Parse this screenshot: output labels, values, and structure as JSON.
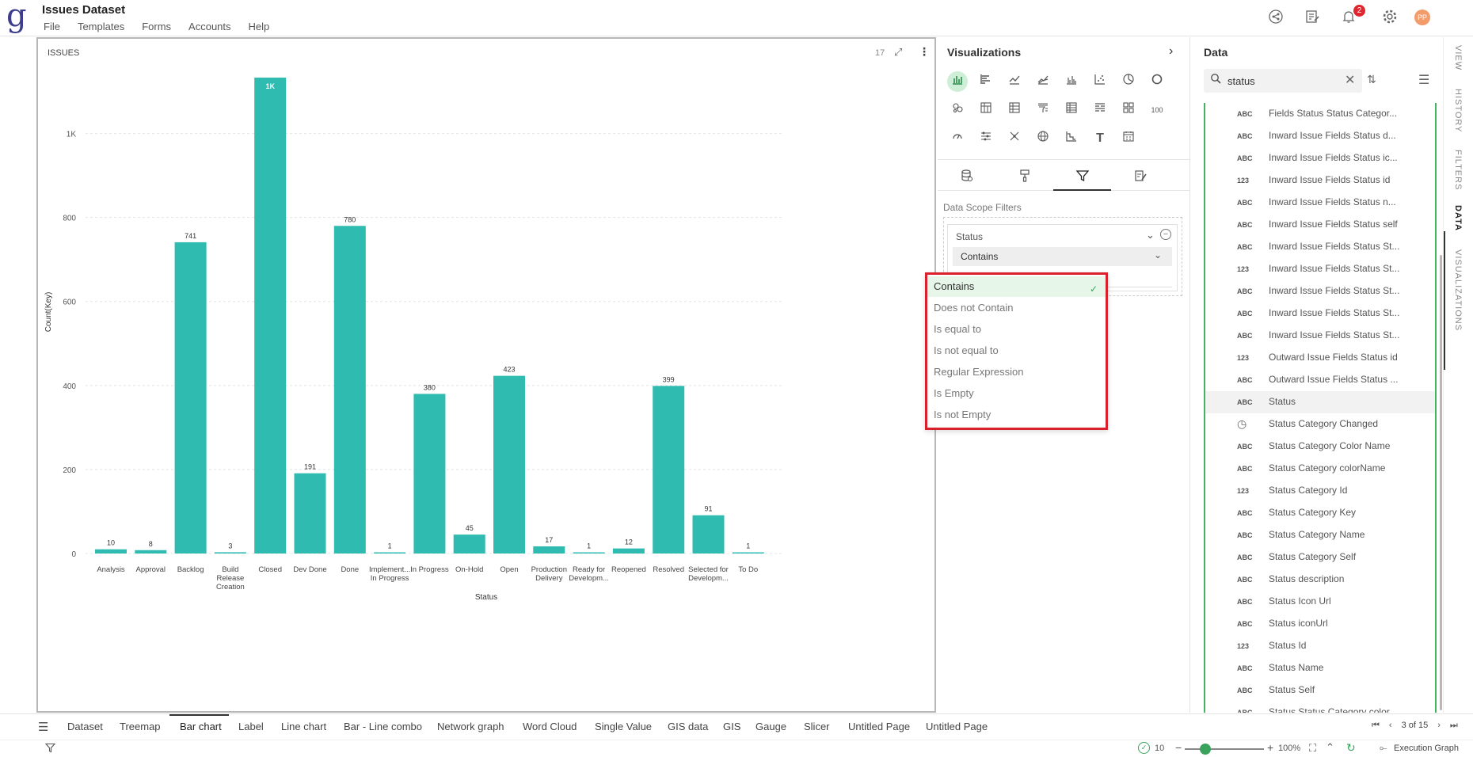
{
  "app": {
    "logo": "g",
    "title": "Issues Dataset",
    "menu": [
      "File",
      "Templates",
      "Forms",
      "Accounts",
      "Help"
    ],
    "notification_count": "2",
    "avatar_initials": "PP"
  },
  "chart_panel": {
    "title": "ISSUES",
    "count": "17"
  },
  "chart_data": {
    "type": "bar",
    "title": "",
    "xlabel": "Status",
    "ylabel": "Count(Key)",
    "ylim": [
      0,
      1150
    ],
    "yticks": [
      0,
      200,
      400,
      600,
      800,
      1000
    ],
    "ytick_labels": [
      "0",
      "200",
      "400",
      "600",
      "800",
      "1K"
    ],
    "categories": [
      "Analysis",
      "Approval",
      "Backlog",
      "Build Release Creation",
      "Closed",
      "Dev Done",
      "Done",
      "Implement... In Progress",
      "In Progress",
      "On-Hold",
      "Open",
      "Production Delivery",
      "Ready for Developm...",
      "Reopened",
      "Resolved",
      "Selected for Developm...",
      "To Do"
    ],
    "category_lines": [
      [
        "Analysis"
      ],
      [
        "Approval"
      ],
      [
        "Backlog"
      ],
      [
        "Build",
        "Release",
        "Creation"
      ],
      [
        "Closed"
      ],
      [
        "Dev Done"
      ],
      [
        "Done"
      ],
      [
        "Implement...",
        "In Progress"
      ],
      [
        "In Progress"
      ],
      [
        "On-Hold"
      ],
      [
        "Open"
      ],
      [
        "Production",
        "Delivery"
      ],
      [
        "Ready for",
        "Developm..."
      ],
      [
        "Reopened"
      ],
      [
        "Resolved"
      ],
      [
        "Selected for",
        "Developm..."
      ],
      [
        "To Do"
      ]
    ],
    "values": [
      10,
      8,
      741,
      3,
      1133,
      191,
      780,
      1,
      380,
      45,
      423,
      17,
      1,
      12,
      399,
      91,
      1
    ],
    "data_labels": [
      "10",
      "8",
      "741",
      "3",
      "1K",
      "191",
      "780",
      "1",
      "380",
      "45",
      "423",
      "17",
      "1",
      "12",
      "399",
      "91",
      "1"
    ],
    "bar_color": "#2fbbb0",
    "grid": true,
    "legend": "none"
  },
  "visualizations": {
    "title": "Visualizations",
    "icons": [
      "bar-chart",
      "horizontal-bar",
      "line-chart",
      "area-line",
      "column-group",
      "scatter",
      "pie",
      "donut",
      "bubble",
      "pivot",
      "table-alt",
      "funnel",
      "table",
      "table-list",
      "grid-tiles",
      "single-value",
      "gauge",
      "slicer",
      "network",
      "globe",
      "step-chart",
      "text",
      "calendar"
    ],
    "single_value_label": "100",
    "text_glyph": "T",
    "tabs": [
      "data-source",
      "format",
      "filter",
      "analytics"
    ],
    "data_scope_label": "Data Scope Filters",
    "filter": {
      "field": "Status",
      "operator": "Contains"
    }
  },
  "operator_dropdown": {
    "options": [
      "Contains",
      "Does not Contain",
      "Is equal to",
      "Is not equal to",
      "Regular Expression",
      "Is Empty",
      "Is not Empty"
    ],
    "selected": "Contains"
  },
  "data": {
    "title": "Data",
    "search_value": "status",
    "fields": [
      {
        "type": "ABC",
        "name": "Fields Status Status Categor..."
      },
      {
        "type": "ABC",
        "name": "Inward Issue Fields Status d..."
      },
      {
        "type": "ABC",
        "name": "Inward Issue Fields Status ic..."
      },
      {
        "type": "123",
        "name": "Inward Issue Fields Status id"
      },
      {
        "type": "ABC",
        "name": "Inward Issue Fields Status n..."
      },
      {
        "type": "ABC",
        "name": "Inward Issue Fields Status self"
      },
      {
        "type": "ABC",
        "name": "Inward Issue Fields Status St..."
      },
      {
        "type": "123",
        "name": "Inward Issue Fields Status St..."
      },
      {
        "type": "ABC",
        "name": "Inward Issue Fields Status St..."
      },
      {
        "type": "ABC",
        "name": "Inward Issue Fields Status St..."
      },
      {
        "type": "ABC",
        "name": "Inward Issue Fields Status St..."
      },
      {
        "type": "123",
        "name": "Outward Issue Fields Status id"
      },
      {
        "type": "ABC",
        "name": "Outward Issue Fields Status ..."
      },
      {
        "type": "ABC",
        "name": "Status"
      },
      {
        "type": "clock",
        "name": "Status Category Changed"
      },
      {
        "type": "ABC",
        "name": "Status Category Color Name"
      },
      {
        "type": "ABC",
        "name": "Status Category colorName"
      },
      {
        "type": "123",
        "name": "Status Category Id"
      },
      {
        "type": "ABC",
        "name": "Status Category Key"
      },
      {
        "type": "ABC",
        "name": "Status Category Name"
      },
      {
        "type": "ABC",
        "name": "Status Category Self"
      },
      {
        "type": "ABC",
        "name": "Status description"
      },
      {
        "type": "ABC",
        "name": "Status Icon Url"
      },
      {
        "type": "ABC",
        "name": "Status iconUrl"
      },
      {
        "type": "123",
        "name": "Status Id"
      },
      {
        "type": "ABC",
        "name": "Status Name"
      },
      {
        "type": "ABC",
        "name": "Status Self"
      },
      {
        "type": "ABC",
        "name": "Status Status Category color"
      }
    ],
    "selected_field": "Status"
  },
  "side_tabs": [
    "VIEW",
    "HISTORY",
    "FILTERS",
    "DATA",
    "VISUALIZATIONS"
  ],
  "page_tabs": [
    "Dataset",
    "Treemap",
    "Bar chart",
    "Label",
    "Line chart",
    "Bar - Line combo",
    "Network graph",
    "Word Cloud",
    "Single Value",
    "GIS data",
    "GIS",
    "Gauge",
    "Slicer",
    "Untitled Page",
    "Untitled Page"
  ],
  "active_page_tab": "Bar chart",
  "page_indicator": "3 of 15",
  "status_bar": {
    "execution_count": "10",
    "zoom": "100%",
    "execution_graph": "Execution Graph"
  },
  "colors": {
    "accent_green": "#3aa35b",
    "highlight_red": "#d9202c",
    "bar_teal": "#2fbbb0",
    "logo_blue": "#3d3d8e"
  }
}
